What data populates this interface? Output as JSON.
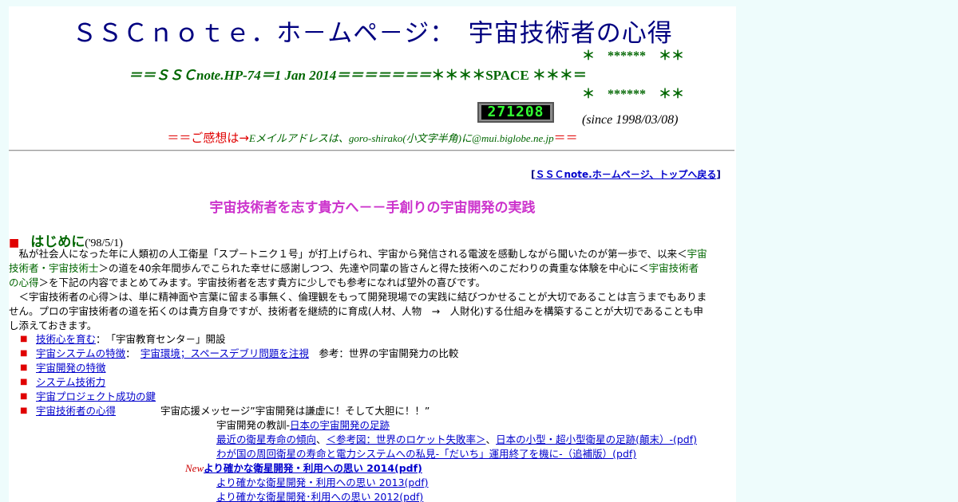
{
  "header": {
    "title": "ＳＳＣｎｏｔｅ．ホ－ムペ－ジ：　宇宙技術者の心得",
    "stars_top": "＊　******　＊＊",
    "hp_line": "＝＝ＳＳＣnote.HP-74＝1 Jan 2014＝＝＝＝＝＝＝",
    "hp_space": "＊＊＊＊SPACE ＊＊＊＝",
    "stars_bottom": "＊　******　＊＊",
    "counter": "271208",
    "since": "(since 1998/03/08)",
    "contact_red_prefix": "＝＝ご感想は→",
    "contact_green": "Eメイルアドレスは、goro-shirako(小文字半角)に@mui.biglobe.ne.jp",
    "contact_red_suffix": "＝＝"
  },
  "nav": {
    "top_link_open": "[",
    "top_link": "ＳＳＣnote.ホ－ムペ－ジ、トップへ戻る",
    "top_link_close": "]"
  },
  "subtitle": "宇宙技術者を志す貴方へ－－手創りの宇宙開発の実践",
  "intro": {
    "bullet": "■",
    "heading": "はじめに",
    "date": "('98/5/1)",
    "p1_a": "　私が社会人になった年に人類初の人工衛星「スプ－トニク１号」が打上げられ、宇宙から発信される電波を感動しながら聞いたのが第一歩で、以来＜",
    "p1_g1": "宇宙",
    "p1_g2": "技術者・宇宙技術士",
    "p1_b": "＞の道を40余年間歩んでこられた幸せに感謝しつつ、先達や同輩の皆さんと得た技術へのこだわりの貴重な体験を中心に＜",
    "p1_g3": "宇宙技術者",
    "p1_g4": "の心得",
    "p1_c": "＞を下記の内容でまとめてみます。宇宙技術者を志す貴方に少しでも参考になれば望外の喜びです。",
    "p2_a": "　＜宇宙技術者の心得＞は、単に精神面や言葉に留まる事無く、倫理観をもって開発現場での実践に結びつかせることが大切であることは言うまでもありま",
    "p2_b": "せん。プロの宇宙技術者の道を拓くのは貴方自身ですが、技術者を継続的に育成(人材、人物　→　人財化)する仕組みを構築することが大切であることも申",
    "p2_c": "し添えておきます。"
  },
  "items": [
    {
      "link": "技術心を育む",
      "after": "：　「宇宙教育センタ－」開設"
    },
    {
      "link": "宇宙システムの特徴",
      "after": "：　",
      "link2": "宇宙環境；スペースデブリ問題を注視",
      "after2": "　参考：世界の宇宙開発力の比較"
    },
    {
      "link": "宇宙開発の特徴"
    },
    {
      "link": "システム技術力"
    },
    {
      "link": "宇宙プロジェクト成功の鍵"
    },
    {
      "link": "宇宙技術者の心得",
      "after": "宇宙応援メッセージ”宇宙開発は謙虚に！そして大胆に！！”"
    }
  ],
  "sublinks": {
    "l1_text": "宇宙開発の教訓-",
    "l1_link": "日本の宇宙開発の足跡",
    "l2_link_a": "最近の衛星寿命の傾向",
    "l2_sep1": "、",
    "l2_link_b": "＜参考図：世界のロケット失敗率＞",
    "l2_sep2": "、",
    "l2_link_c": "日本の小型・超小型衛星の足跡(顛末）-(pdf)",
    "l3_link": "わが国の周回衛星の寿命と電力システムへの私見-「だいち」運用終了を機に-（追補版）(pdf)",
    "l4_new": "New",
    "l4_link": "より確かな衛星開発・利用への思い 2014(pdf)",
    "l5_link": "より確かな衛星開発・利用への思い 2013(pdf)",
    "l6_link": "より確かな衛星開発･利用への思い 2012(pdf)"
  }
}
